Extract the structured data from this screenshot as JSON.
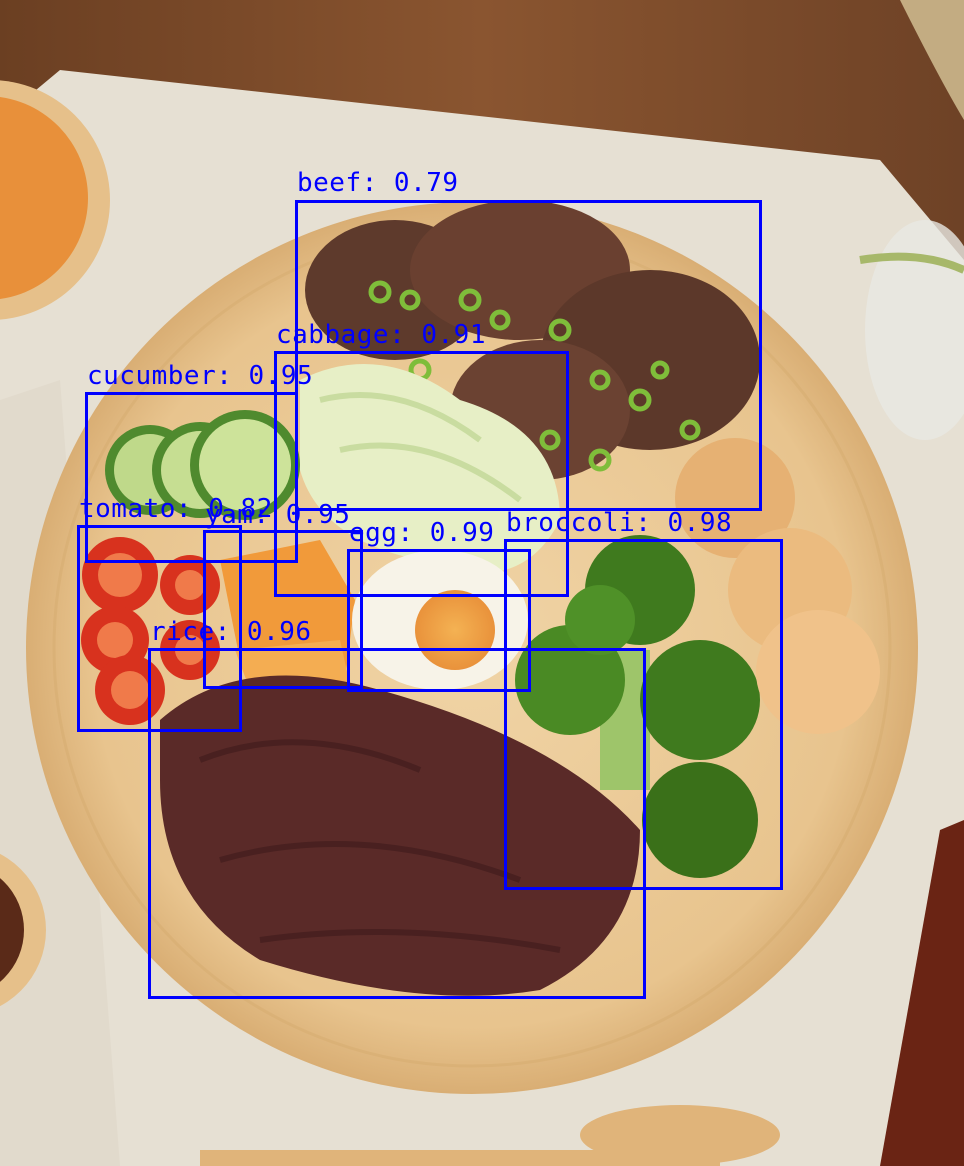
{
  "detections": [
    {
      "label": "beef: 0.79",
      "class": "beef",
      "score": 0.79
    },
    {
      "label": "cabbage: 0.91",
      "class": "cabbage",
      "score": 0.91
    },
    {
      "label": "cucumber: 0.95",
      "class": "cucumber",
      "score": 0.95
    },
    {
      "label": "tomato: 0.82",
      "class": "tomato",
      "score": 0.82
    },
    {
      "label": "yam: 0.95",
      "class": "yam",
      "score": 0.95
    },
    {
      "label": "egg: 0.99",
      "class": "egg",
      "score": 0.99
    },
    {
      "label": "broccoli: 0.98",
      "class": "broccoli",
      "score": 0.98
    },
    {
      "label": "rice: 0.96",
      "class": "rice",
      "score": 0.96
    }
  ],
  "colors": {
    "box": "#0000ff",
    "table_wood": "#7a4a2a",
    "cloth": "#e8e2d6",
    "plate": "#e8c48e",
    "soup": "#e8903a"
  }
}
